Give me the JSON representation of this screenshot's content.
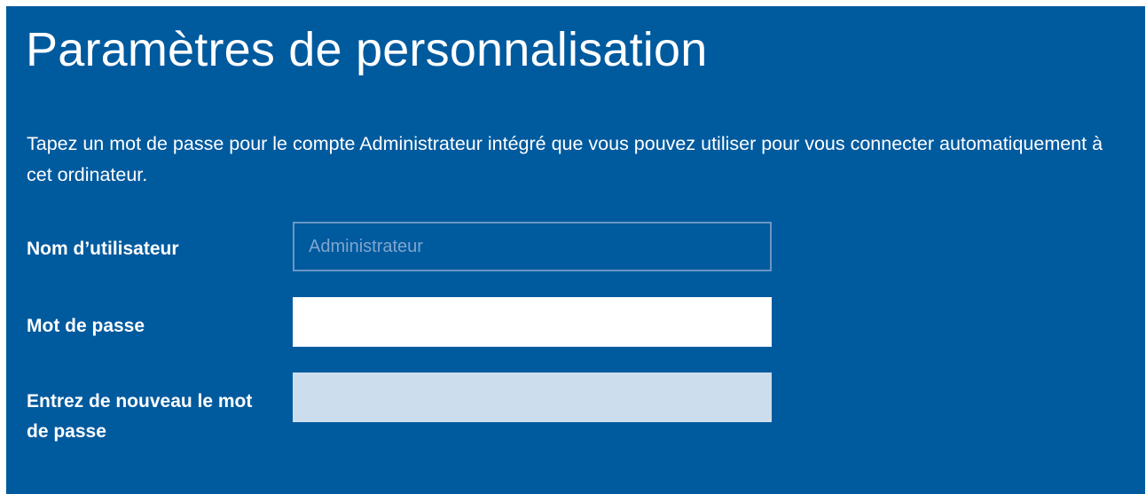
{
  "page": {
    "title": "Paramètres de personnalisation",
    "description": "Tapez un mot de passe pour le compte Administrateur intégré que vous pouvez utiliser pour vous connecter automatiquement à cet ordinateur."
  },
  "form": {
    "username": {
      "label": "Nom d’utilisateur",
      "value": "Administrateur"
    },
    "password": {
      "label": "Mot de passe",
      "value": ""
    },
    "confirm_password": {
      "label": "Entrez de nouveau le mot de passe",
      "value": ""
    }
  },
  "colors": {
    "background": "#005a9e",
    "text": "#ffffff",
    "disabled_field_border": "#6b97c4",
    "confirm_field_fill": "#ccdded"
  }
}
